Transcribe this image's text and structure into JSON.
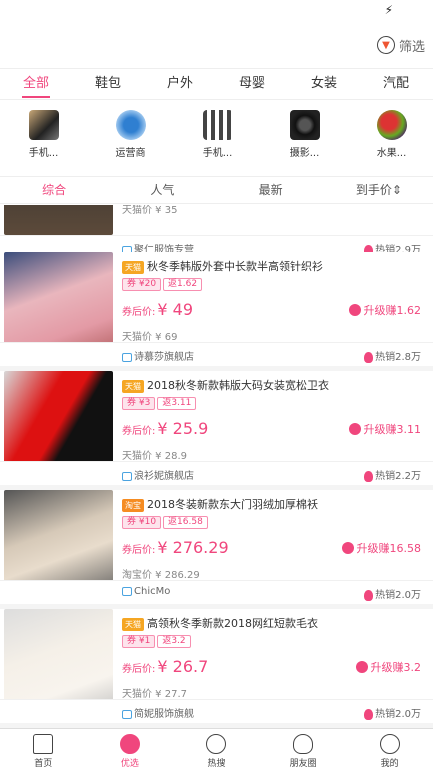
{
  "filter": {
    "label": "筛选"
  },
  "category_tabs": [
    {
      "label": "全部",
      "active": true
    },
    {
      "label": "鞋包",
      "active": false
    },
    {
      "label": "户外",
      "active": false
    },
    {
      "label": "母婴",
      "active": false
    },
    {
      "label": "女装",
      "active": false
    },
    {
      "label": "汽配",
      "active": false
    }
  ],
  "icon_strip": [
    {
      "label": "手机...",
      "icon": "phone"
    },
    {
      "label": "运营商",
      "icon": "mobile"
    },
    {
      "label": "手机...",
      "icon": "cable"
    },
    {
      "label": "摄影...",
      "icon": "camera"
    },
    {
      "label": "水果...",
      "icon": "fruit"
    }
  ],
  "sort_bar": [
    {
      "label": "综合",
      "active": true
    },
    {
      "label": "人气",
      "active": false
    },
    {
      "label": "最新",
      "active": false
    },
    {
      "label": "到手价⇕",
      "active": false
    }
  ],
  "partial_item": {
    "orig_price": "天猫价 ¥ 35",
    "shop": "聚仁服饰专营",
    "sales": "热销2.9万"
  },
  "products": [
    {
      "badge": "天猫",
      "title": "秋冬季韩版外套中长款半高领针织衫",
      "coupon": "券 ¥20",
      "rebate": "返1.62",
      "price_label": "券后价:",
      "price": "¥ 49",
      "earn": "升级赚1.62",
      "orig_price": "天猫价 ¥ 69",
      "shop": "诗慕莎旗舰店",
      "sales": "热销2.8万"
    },
    {
      "badge": "天猫",
      "title": "2018秋冬新款韩版大码女装宽松卫衣",
      "coupon": "券 ¥3",
      "rebate": "返3.11",
      "price_label": "券后价:",
      "price": "¥ 25.9",
      "earn": "升级赚3.11",
      "orig_price": "天猫价 ¥ 28.9",
      "shop": "浪衫妮旗舰店",
      "sales": "热销2.2万"
    },
    {
      "badge": "淘宝",
      "title": "2018冬装新款东大门羽绒加厚棉袄",
      "coupon": "券 ¥10",
      "rebate": "返16.58",
      "price_label": "券后价:",
      "price": "¥ 276.29",
      "earn": "升级赚16.58",
      "orig_price": "淘宝价 ¥ 286.29",
      "shop": "ChicMo",
      "sales": "热销2.0万"
    },
    {
      "badge": "天猫",
      "title": "高领秋冬季新款2018网红短款毛衣",
      "coupon": "券 ¥1",
      "rebate": "返3.2",
      "price_label": "券后价:",
      "price": "¥ 26.7",
      "earn": "升级赚3.2",
      "orig_price": "天猫价 ¥ 27.7",
      "shop": "简妮服饰旗舰",
      "sales": "热销2.0万"
    }
  ],
  "bottom_nav": [
    {
      "label": "首页",
      "icon": "home",
      "active": false
    },
    {
      "label": "优选",
      "icon": "preferred",
      "active": true
    },
    {
      "label": "热搜",
      "icon": "hot-search",
      "active": false
    },
    {
      "label": "朋友圈",
      "icon": "friends",
      "active": false
    },
    {
      "label": "我的",
      "icon": "mine",
      "active": false
    }
  ],
  "accent_color": "#f0467d"
}
